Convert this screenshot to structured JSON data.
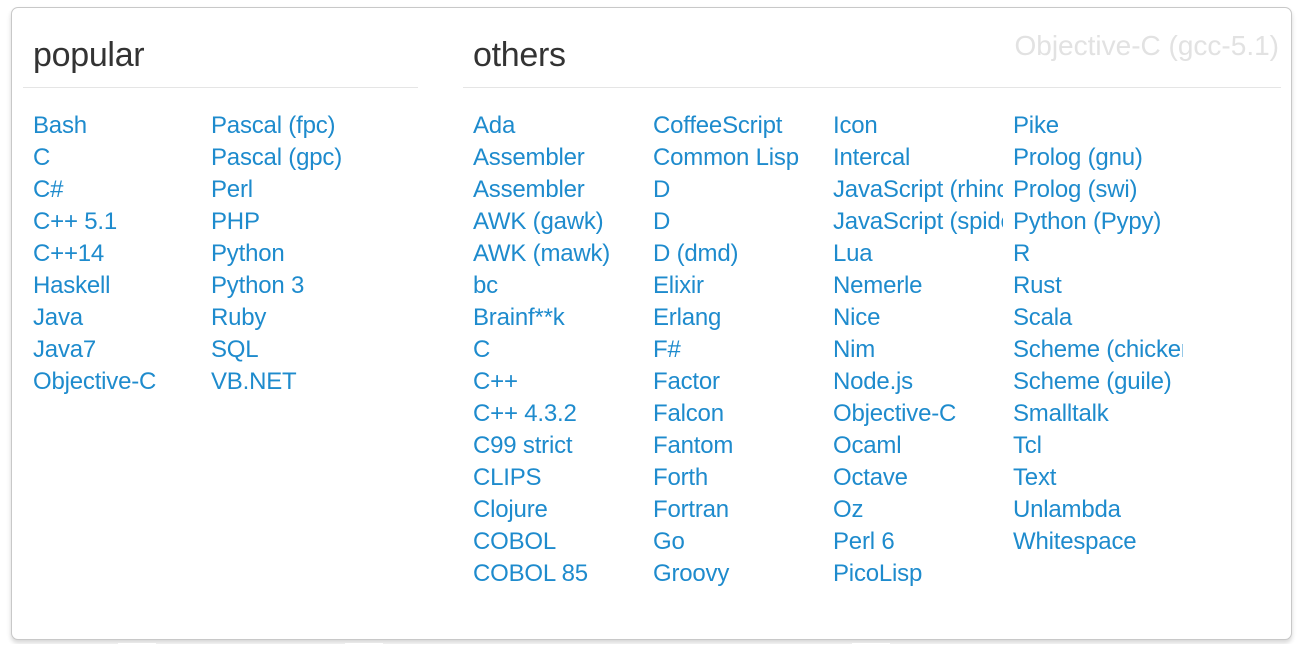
{
  "header": {
    "corner_title": "Objective-C (gcc-5.1)",
    "corner_color": "#e2e2e2"
  },
  "theme": {
    "link_color": "#1e8bcd",
    "heading_color": "#333333",
    "rule_color": "#e5e5e5",
    "panel_border": "#c8c8c8",
    "background": "#ffffff"
  },
  "sections": [
    {
      "id": "popular",
      "title": "popular",
      "columns": [
        [
          "Bash",
          "C",
          "C#",
          "C++ 5.1",
          "C++14",
          "Haskell",
          "Java",
          "Java7",
          "Objective-C"
        ],
        [
          "Pascal (fpc)",
          "Pascal (gpc)",
          "Perl",
          "PHP",
          "Python",
          "Python 3",
          "Ruby",
          "SQL",
          "VB.NET"
        ]
      ]
    },
    {
      "id": "others",
      "title": "others",
      "columns": [
        [
          "Ada",
          "Assembler",
          "Assembler",
          "AWK (gawk)",
          "AWK (mawk)",
          "bc",
          "Brainf**k",
          "C",
          "C++",
          "C++ 4.3.2",
          "C99 strict",
          "CLIPS",
          "Clojure",
          "COBOL",
          "COBOL 85"
        ],
        [
          "CoffeeScript",
          "Common Lisp",
          "D",
          "D",
          "D (dmd)",
          "Elixir",
          "Erlang",
          "F#",
          "Factor",
          "Falcon",
          "Fantom",
          "Forth",
          "Fortran",
          "Go",
          "Groovy"
        ],
        [
          "Icon",
          "Intercal",
          "JavaScript (rhino)",
          "JavaScript (spidermonkey)",
          "Lua",
          "Nemerle",
          "Nice",
          "Nim",
          "Node.js",
          "Objective-C",
          "Ocaml",
          "Octave",
          "Oz",
          "Perl 6",
          "PicoLisp"
        ],
        [
          "Pike",
          "Prolog (gnu)",
          "Prolog (swi)",
          "Python (Pypy)",
          "R",
          "Rust",
          "Scala",
          "Scheme (chicken)",
          "Scheme (guile)",
          "Smalltalk",
          "Tcl",
          "Text",
          "Unlambda",
          "Whitespace"
        ]
      ]
    }
  ]
}
